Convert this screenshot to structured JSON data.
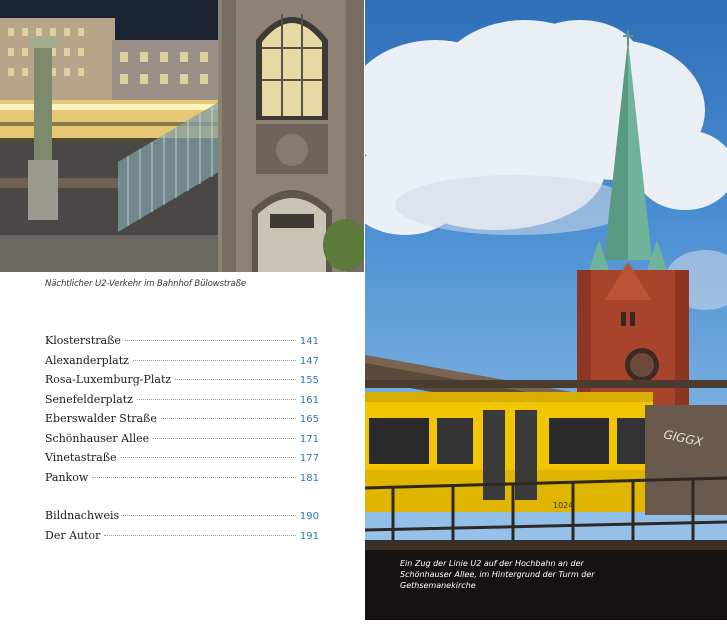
{
  "left_photo": {
    "caption": "Nächtlicher U2-Verkehr im Bahnhof Bülowstraße"
  },
  "toc": {
    "entries": [
      {
        "title": "Klosterstraße",
        "page": "141"
      },
      {
        "title": "Alexanderplatz",
        "page": "147"
      },
      {
        "title": "Rosa-Luxemburg-Platz",
        "page": "155"
      },
      {
        "title": "Senefelderplatz",
        "page": "161"
      },
      {
        "title": "Eberswalder Straße",
        "page": "165"
      },
      {
        "title": "Schönhauser Allee",
        "page": "171"
      },
      {
        "title": "Vinetastraße",
        "page": "177"
      },
      {
        "title": "Pankow",
        "page": "181"
      }
    ],
    "appendix": [
      {
        "title": "Bildnachweis",
        "page": "190"
      },
      {
        "title": "Der Autor",
        "page": "191"
      }
    ]
  },
  "right_photo": {
    "caption": "Ein Zug der Linie U2 auf der Hochbahn an der Schönhauser Allee, im Hintergrund der Turm der Gethsemanekirche",
    "train_number": "1024",
    "graffiti": "GIGGX"
  },
  "colors": {
    "page_number": "#2b7bbd",
    "train_yellow": "#f2c500",
    "sky": "#4a8ed2",
    "brick": "#a8442c",
    "copper_spire": "#6fb39a"
  }
}
